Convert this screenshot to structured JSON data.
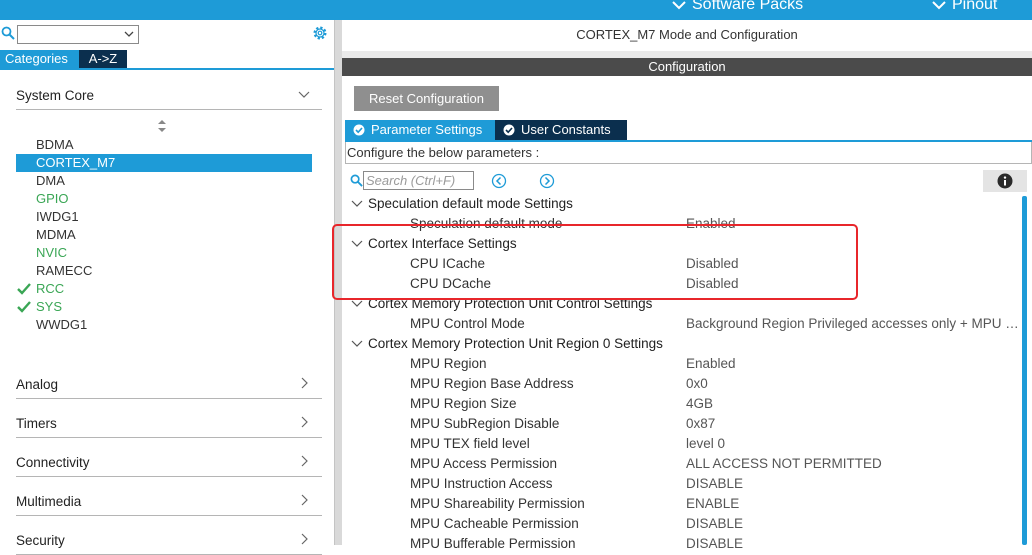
{
  "topbar": {
    "software_packs": "Software Packs",
    "pinout": "Pinout"
  },
  "left": {
    "tabs": {
      "categories": "Categories",
      "az": "A->Z"
    },
    "system_core": "System Core",
    "items": [
      {
        "label": "BDMA",
        "style": "normal",
        "checked": false
      },
      {
        "label": "CORTEX_M7",
        "style": "selected",
        "checked": false
      },
      {
        "label": "DMA",
        "style": "normal",
        "checked": false
      },
      {
        "label": "GPIO",
        "style": "green",
        "checked": false
      },
      {
        "label": "IWDG1",
        "style": "normal",
        "checked": false
      },
      {
        "label": "MDMA",
        "style": "normal",
        "checked": false
      },
      {
        "label": "NVIC",
        "style": "green",
        "checked": false
      },
      {
        "label": "RAMECC",
        "style": "normal",
        "checked": false
      },
      {
        "label": "RCC",
        "style": "green",
        "checked": true
      },
      {
        "label": "SYS",
        "style": "green",
        "checked": true
      },
      {
        "label": "WWDG1",
        "style": "normal",
        "checked": false
      }
    ],
    "groups": [
      "Analog",
      "Timers",
      "Connectivity",
      "Multimedia",
      "Security"
    ]
  },
  "right": {
    "title": "CORTEX_M7 Mode and Configuration",
    "config_header": "Configuration",
    "reset_button": "Reset Configuration",
    "tabs": {
      "parameter_settings": "Parameter Settings",
      "user_constants": "User Constants"
    },
    "configure_text": "Configure the below parameters :",
    "search_placeholder": "Search (Ctrl+F)",
    "rows": [
      {
        "kind": "section",
        "name": "Speculation default mode Settings"
      },
      {
        "kind": "param",
        "name": "Speculation default mode",
        "value": "Enabled",
        "strike": true
      },
      {
        "kind": "section",
        "name": "Cortex Interface Settings"
      },
      {
        "kind": "param",
        "name": "CPU ICache",
        "value": "Disabled"
      },
      {
        "kind": "param",
        "name": "CPU DCache",
        "value": "Disabled"
      },
      {
        "kind": "section",
        "name": "Cortex Memory Protection Unit Control Settings",
        "strike": true
      },
      {
        "kind": "param",
        "name": "MPU Control Mode",
        "value": "Background Region Privileged accesses only + MPU Di..."
      },
      {
        "kind": "section",
        "name": "Cortex Memory Protection Unit Region 0 Settings"
      },
      {
        "kind": "param",
        "name": "MPU Region",
        "value": "Enabled"
      },
      {
        "kind": "param",
        "name": "MPU Region Base Address",
        "value": "0x0"
      },
      {
        "kind": "param",
        "name": "MPU Region Size",
        "value": "4GB"
      },
      {
        "kind": "param",
        "name": "MPU SubRegion Disable",
        "value": "0x87"
      },
      {
        "kind": "param",
        "name": "MPU TEX field level",
        "value": "level 0"
      },
      {
        "kind": "param",
        "name": "MPU Access Permission",
        "value": "ALL ACCESS NOT PERMITTED"
      },
      {
        "kind": "param",
        "name": "MPU Instruction Access",
        "value": "DISABLE"
      },
      {
        "kind": "param",
        "name": "MPU Shareability Permission",
        "value": "ENABLE"
      },
      {
        "kind": "param",
        "name": "MPU Cacheable Permission",
        "value": "DISABLE"
      },
      {
        "kind": "param",
        "name": "MPU Bufferable  Permission",
        "value": "DISABLE"
      }
    ]
  },
  "colors": {
    "accent": "#1e9bd7",
    "dark_tab": "#0b2f4e",
    "green": "#3aa655",
    "highlight": "#e8262b"
  }
}
